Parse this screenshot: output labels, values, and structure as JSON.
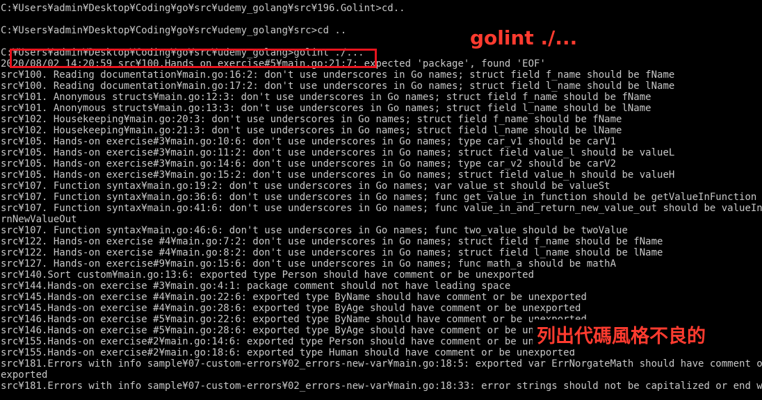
{
  "terminal": {
    "lines": [
      "C:¥Users¥admin¥Desktop¥Coding¥go¥src¥udemy_golang¥src¥196.Golint>cd..",
      "",
      "C:¥Users¥admin¥Desktop¥Coding¥go¥src¥udemy_golang¥src>cd ..",
      "",
      "C:¥Users¥admin¥Desktop¥Coding¥go¥src¥udemy_golang>golint ./...",
      "2020/08/02 14:20:59 src¥100.Hands on exercise#5¥main.go:21:7: expected 'package', found 'EOF'",
      "src¥100. Reading documentation¥main.go:16:2: don't use underscores in Go names; struct field f_name should be fName",
      "src¥100. Reading documentation¥main.go:17:2: don't use underscores in Go names; struct field l_name should be lName",
      "src¥101. Anonymous structs¥main.go:12:3: don't use underscores in Go names; struct field f_name should be fName",
      "src¥101. Anonymous structs¥main.go:13:3: don't use underscores in Go names; struct field l_name should be lName",
      "src¥102. Housekeeping¥main.go:20:3: don't use underscores in Go names; struct field f_name should be fName",
      "src¥102. Housekeeping¥main.go:21:3: don't use underscores in Go names; struct field l_name should be lName",
      "src¥105. Hands-on exercise#3¥main.go:10:6: don't use underscores in Go names; type car_v1 should be carV1",
      "src¥105. Hands-on exercise#3¥main.go:11:2: don't use underscores in Go names; struct field value_l should be valueL",
      "src¥105. Hands-on exercise#3¥main.go:14:6: don't use underscores in Go names; type car_v2 should be carV2",
      "src¥105. Hands-on exercise#3¥main.go:15:2: don't use underscores in Go names; struct field value_h should be valueH",
      "src¥107. Function syntax¥main.go:19:2: don't use underscores in Go names; var value_st should be valueSt",
      "src¥107. Function syntax¥main.go:36:6: don't use underscores in Go names; func get_value_in_function should be getValueInFunction",
      "src¥107. Function syntax¥main.go:41:6: don't use underscores in Go names; func value_in_and_return_new_value_out should be valueInAndRetu",
      "rnNewValueOut",
      "src¥107. Function syntax¥main.go:46:6: don't use underscores in Go names; func two_value should be twoValue",
      "src¥122. Hands-on exercise #4¥main.go:7:2: don't use underscores in Go names; struct field f_name should be fName",
      "src¥122. Hands-on exercise #4¥main.go:8:2: don't use underscores in Go names; struct field l_name should be lName",
      "src¥127. Hands-on exercise#9¥main.go:15:6: don't use underscores in Go names; func math_a should be mathA",
      "src¥140.Sort custom¥main.go:13:6: exported type Person should have comment or be unexported",
      "src¥144.Hands-on exercise #3¥main.go:4:1: package comment should not have leading space",
      "src¥145.Hands-on exercise #4¥main.go:22:6: exported type ByName should have comment or be unexported",
      "src¥145.Hands-on exercise #4¥main.go:28:6: exported type ByAge should have comment or be unexported",
      "src¥146.Hands-on exercise #5¥main.go:22:6: exported type ByName should have comment or be unexported",
      "src¥146.Hands-on exercise #5¥main.go:28:6: exported type ByAge should have comment or be unexported",
      "src¥155.Hands-on exercise#2¥main.go:14:6: exported type Person should have comment or be unexported",
      "src¥155.Hands-on exercise#2¥main.go:18:6: exported type Human should have comment or be unexported",
      "src¥181.Errors with info sample¥07-custom-errors¥02_errors-new-var¥main.go:18:5: exported var ErrNorgateMath should have comment or be un",
      "exported",
      "src¥181.Errors with info sample¥07-custom-errors¥02_errors-new-var¥main.go:18:33: error strings should not be capitalized or end with pun"
    ]
  },
  "annotations": {
    "command_label": "golint ./...",
    "note_label": "列出代碼風格不良的"
  },
  "colors": {
    "background": "#000000",
    "text": "#c8c8c8",
    "annotation": "#e8141e"
  }
}
